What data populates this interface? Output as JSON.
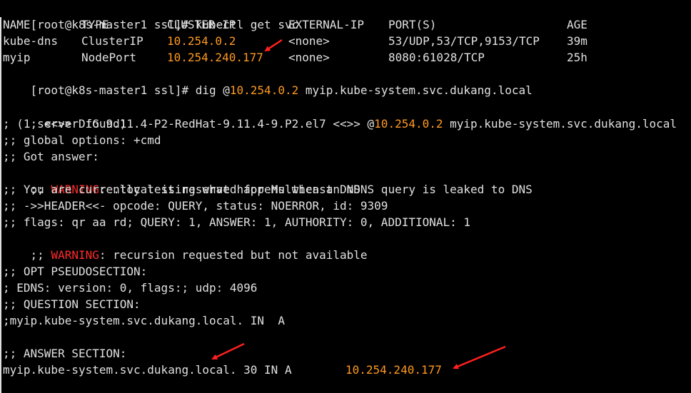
{
  "colors": {
    "background": "#000000",
    "text": "#e0e0e0",
    "ip_highlight": "#ff9a1f",
    "warning": "#ff2a2a",
    "arrow": "#ff2020"
  },
  "prompt1": {
    "prompt": "[root@k8s-master1 ssl]# ",
    "command": "kubectl get svc"
  },
  "svc_table": {
    "headers": [
      "NAME",
      "TYPE",
      "CLUSTER-IP",
      "EXTERNAL-IP",
      "PORT(S)",
      "AGE"
    ],
    "rows": [
      [
        "kube-dns",
        "ClusterIP",
        "10.254.0.2",
        "<none>",
        "53/UDP,53/TCP,9153/TCP",
        "39m"
      ],
      [
        "myip",
        "NodePort",
        "10.254.240.177",
        "<none>",
        "8080:61028/TCP",
        "25h"
      ]
    ]
  },
  "prompt2": {
    "prompt": "[root@k8s-master1 ssl]# ",
    "cmd_start": "dig @",
    "server_ip": "10.254.0.2",
    "cmd_end": " myip.kube-system.svc.dukang.local"
  },
  "dig_header": {
    "pre": "; <<>> DiG 9.11.4-P2-RedHat-9.11.4-9.P2.el7 <<>> @",
    "ip": "10.254.0.2",
    "post": " myip.kube-system.svc.dukang.local"
  },
  "server_found": "; (1 server found)",
  "global_options": ";; global options: +cmd",
  "got_answer": ";; Got answer:",
  "warning1": {
    "prefix": ";; ",
    "label": "WARNING",
    "text": ": .local is reserved for Multicast DNS"
  },
  "mdns_line": ";; You are currently testing what happens when an mDNS query is leaked to DNS",
  "header_line": ";; ->>HEADER<<- opcode: QUERY, status: NOERROR, id: 9309",
  "flags_line": ";; flags: qr aa rd; QUERY: 1, ANSWER: 1, AUTHORITY: 0, ADDITIONAL: 1",
  "warning2": {
    "prefix": ";; ",
    "label": "WARNING",
    "text": ": recursion requested but not available"
  },
  "opt_section": ";; OPT PSEUDOSECTION:",
  "edns_line": "; EDNS: version: 0, flags:; udp: 4096",
  "question_section": ";; QUESTION SECTION:",
  "question_line": ";myip.kube-system.svc.dukang.local. IN  A",
  "answer_section": ";; ANSWER SECTION:",
  "answer_record": {
    "text": "myip.kube-system.svc.dukang.local. 30 IN A",
    "ip": "10.254.240.177"
  }
}
